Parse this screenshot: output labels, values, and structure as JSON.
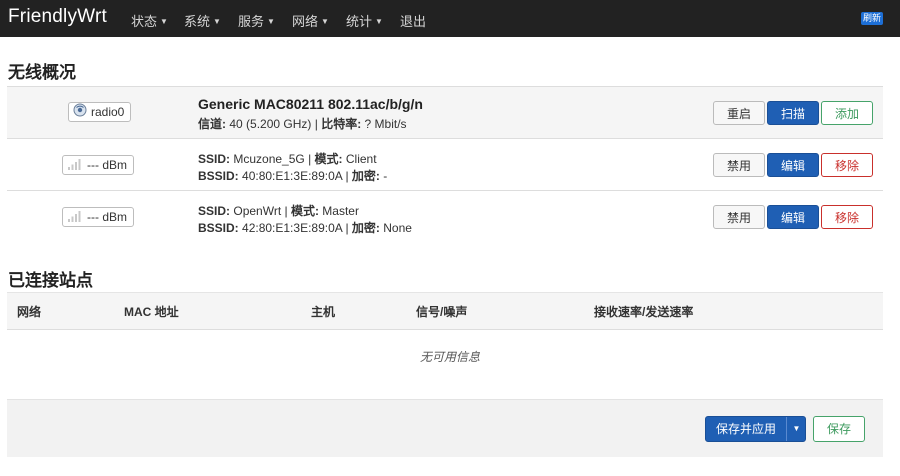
{
  "navbar": {
    "brand": "FriendlyWrt",
    "items": [
      {
        "label": "状态",
        "has_dropdown": true
      },
      {
        "label": "系统",
        "has_dropdown": true
      },
      {
        "label": "服务",
        "has_dropdown": true
      },
      {
        "label": "网络",
        "has_dropdown": true
      },
      {
        "label": "统计",
        "has_dropdown": true
      },
      {
        "label": "退出",
        "has_dropdown": false
      }
    ],
    "refresh_label": "刷新",
    "caret": "▼"
  },
  "wireless": {
    "title": "无线概况",
    "radio": {
      "badge": "radio0",
      "name": "Generic MAC80211 802.11ac/b/g/n",
      "channel_label": "信道:",
      "channel_value": "40 (5.200 GHz)",
      "bitrate_label": "比特率:",
      "bitrate_value": "? Mbit/s",
      "buttons": {
        "restart": "重启",
        "scan": "扫描",
        "add": "添加"
      }
    },
    "networks": [
      {
        "signal": "--- dBm",
        "ssid_label": "SSID:",
        "ssid": "Mcuzone_5G",
        "mode_label": "模式:",
        "mode": "Client",
        "bssid_label": "BSSID:",
        "bssid": "40:80:E1:3E:89:0A",
        "enc_label": "加密:",
        "enc": "-",
        "buttons": {
          "disable": "禁用",
          "edit": "编辑",
          "remove": "移除"
        }
      },
      {
        "signal": "--- dBm",
        "ssid_label": "SSID:",
        "ssid": "OpenWrt",
        "mode_label": "模式:",
        "mode": "Master",
        "bssid_label": "BSSID:",
        "bssid": "42:80:E1:3E:89:0A",
        "enc_label": "加密:",
        "enc": "None",
        "buttons": {
          "disable": "禁用",
          "edit": "编辑",
          "remove": "移除"
        }
      }
    ]
  },
  "stations": {
    "title": "已连接站点",
    "columns": [
      "网络",
      "MAC 地址",
      "主机",
      "信号/噪声",
      "接收速率/发送速率"
    ],
    "empty_message": "无可用信息"
  },
  "footer": {
    "save_apply": "保存并应用",
    "save": "保存"
  },
  "colors": {
    "navbar_bg": "#222222",
    "primary": "#1f5fb4",
    "success": "#46a36a",
    "danger": "#c9302c"
  }
}
